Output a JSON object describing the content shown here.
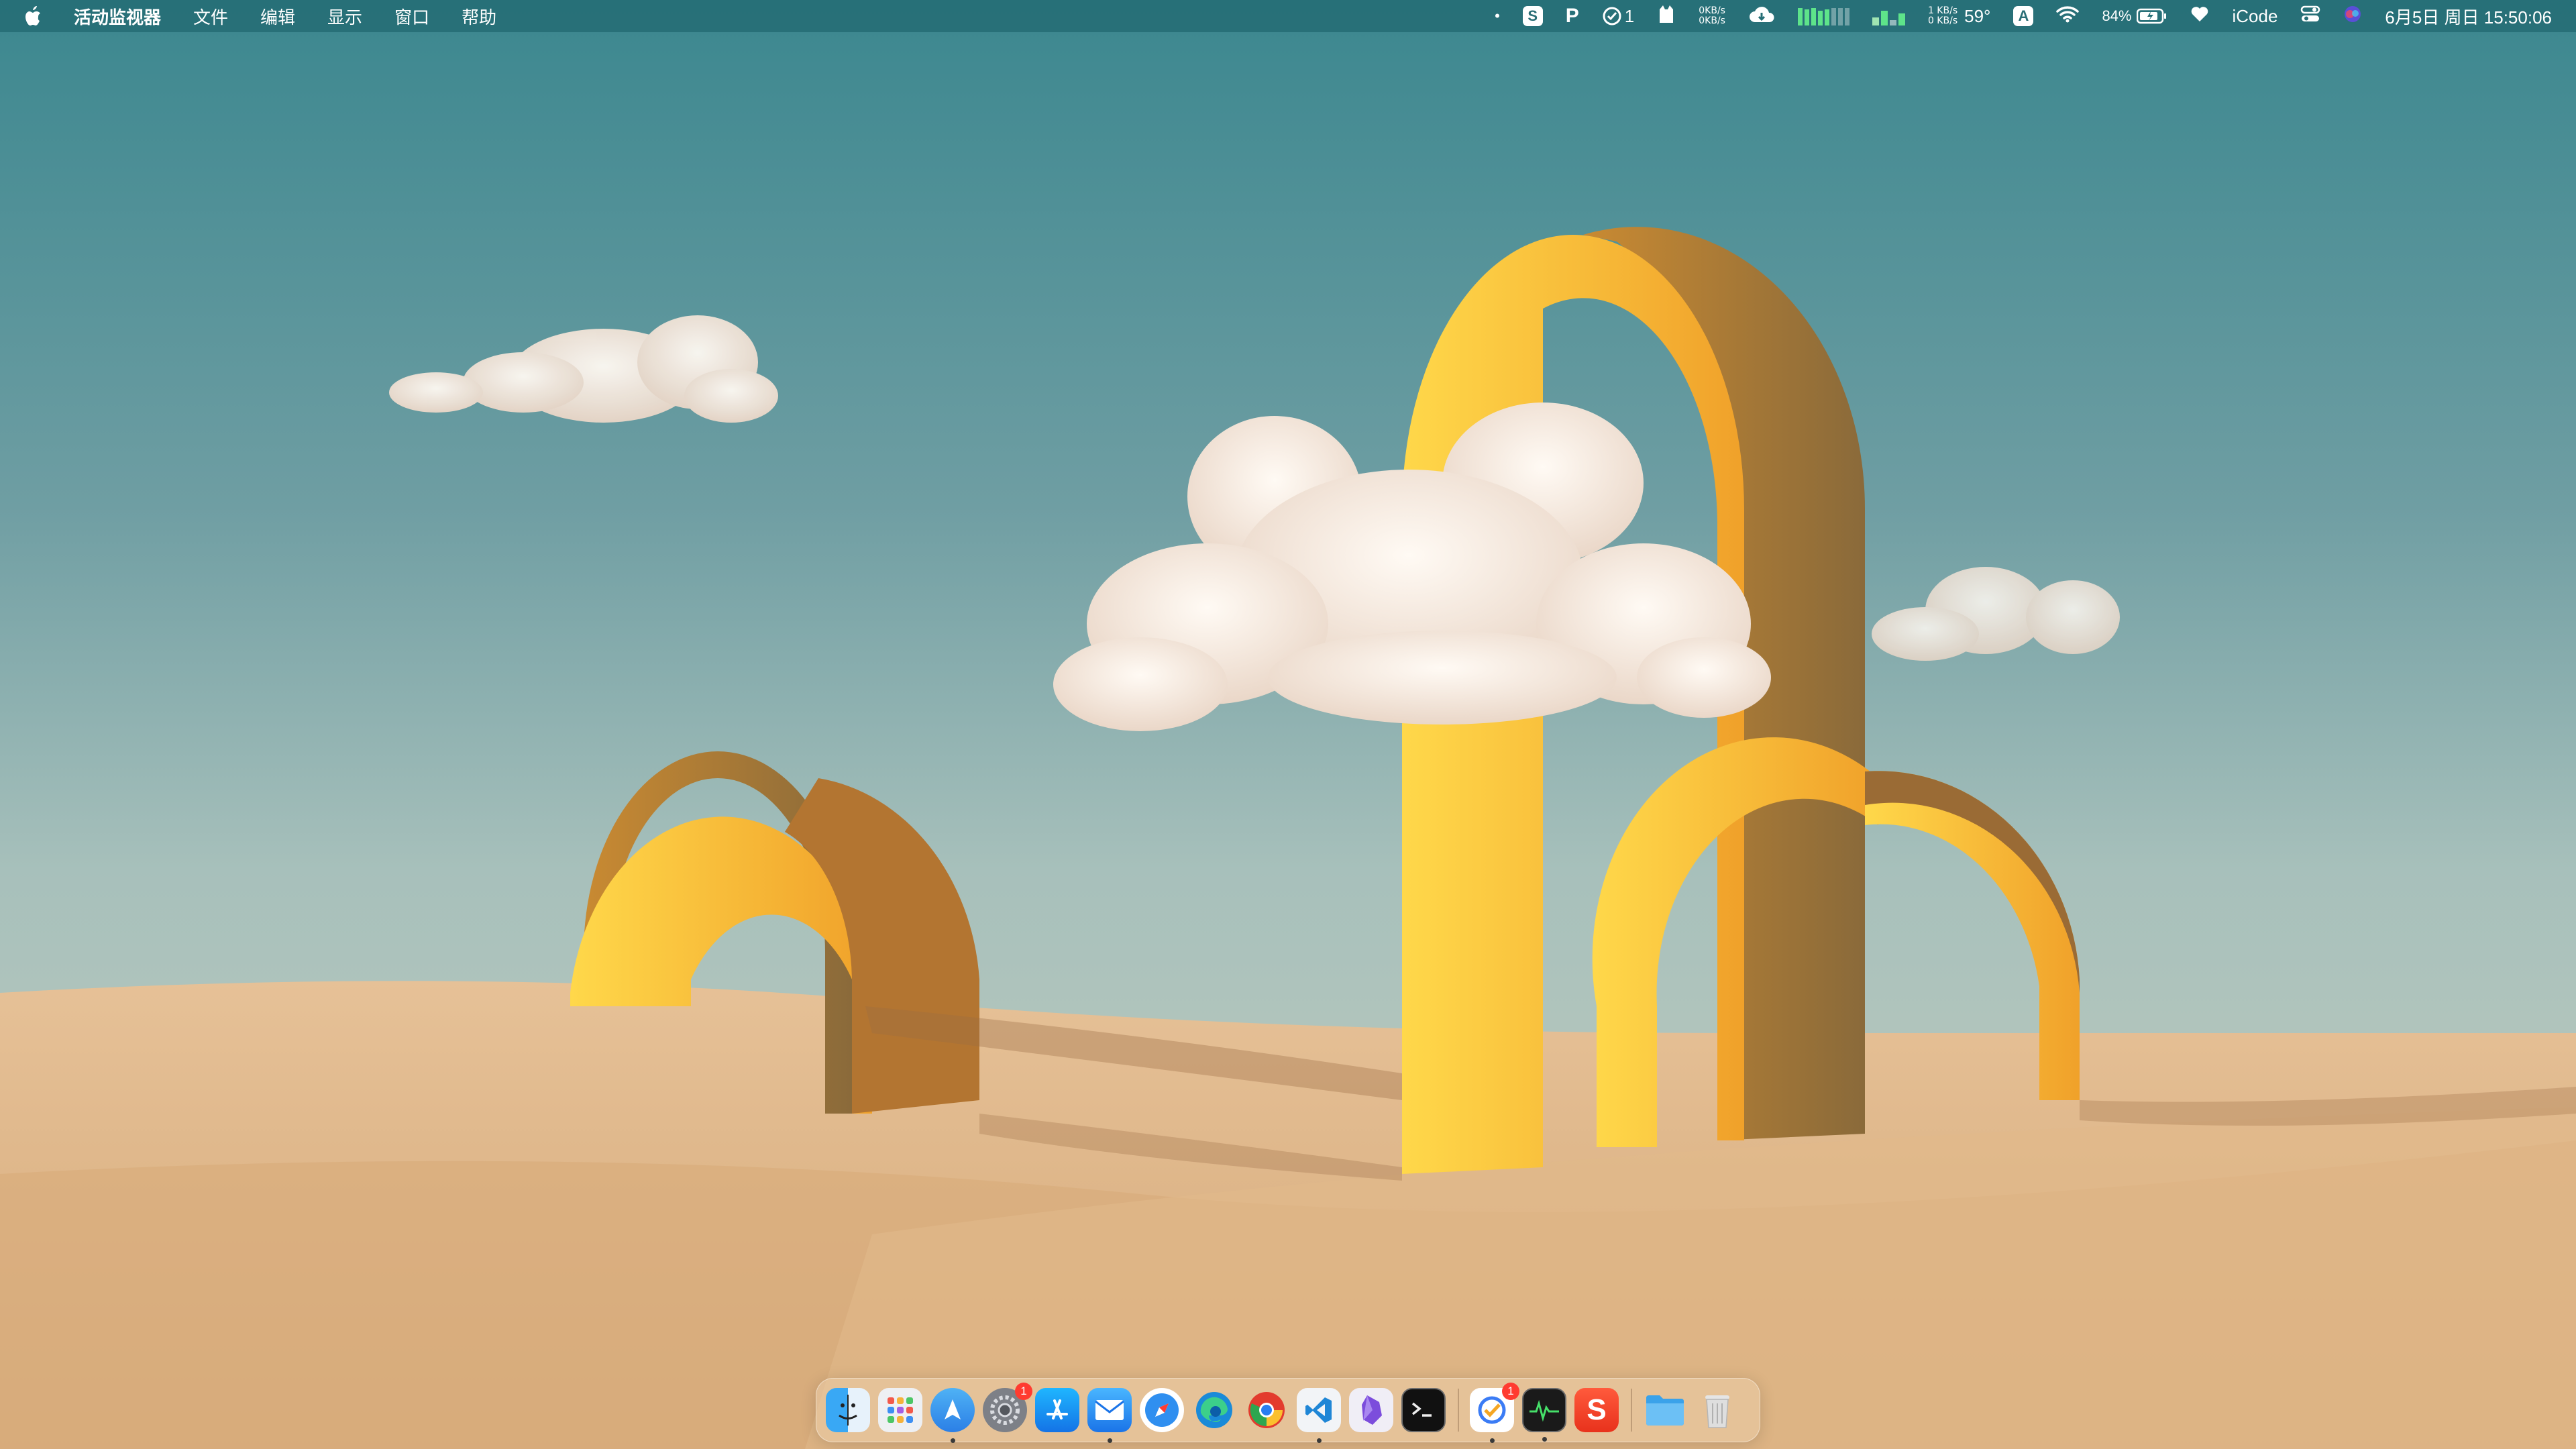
{
  "menubar": {
    "app_name": "活动监视器",
    "menus": [
      "文件",
      "编辑",
      "显示",
      "窗口",
      "帮助"
    ],
    "status": {
      "net_upload": "0KB/s",
      "net_download": "0KB/s",
      "net2_upload": "1 KB/s",
      "net2_download": "0 KB/s",
      "temperature": "59°",
      "input_source": "A",
      "checklist_count": "1",
      "battery_percent": "84%",
      "icode_label": "iCode",
      "datetime": "6月5日 周日 15:50:06"
    },
    "icons": [
      "apple-icon",
      "dot-icon",
      "skype-icon",
      "p-icon",
      "checklist-icon",
      "cat-icon",
      "cloud-icon",
      "cpu-graph-icon",
      "memory-graph-icon",
      "wifi-icon",
      "battery-icon",
      "heart-icon",
      "control-center-icon",
      "siri-icon"
    ]
  },
  "dock": {
    "apps": [
      {
        "name": "Finder",
        "icon": "finder-icon",
        "running": false
      },
      {
        "name": "Launchpad",
        "icon": "launchpad-icon",
        "running": false
      },
      {
        "name": "Maps",
        "icon": "maps-icon",
        "running": true
      },
      {
        "name": "System Preferences",
        "icon": "settings-icon",
        "running": false,
        "badge": "1"
      },
      {
        "name": "App Store",
        "icon": "app-store-icon",
        "running": false
      },
      {
        "name": "Mail",
        "icon": "mail-icon",
        "running": true
      },
      {
        "name": "Safari",
        "icon": "safari-icon",
        "running": false
      },
      {
        "name": "Edge",
        "icon": "edge-icon",
        "running": false
      },
      {
        "name": "Chrome",
        "icon": "chrome-icon",
        "running": false
      },
      {
        "name": "VS Code",
        "icon": "vscode-icon",
        "running": true
      },
      {
        "name": "Obsidian",
        "icon": "obsidian-icon",
        "running": false
      },
      {
        "name": "Terminal",
        "icon": "terminal-icon",
        "running": false
      },
      {
        "name": "Task App",
        "icon": "task-icon",
        "running": true,
        "badge": "1"
      },
      {
        "name": "Activity Monitor",
        "icon": "activity-monitor-icon",
        "running": true
      },
      {
        "name": "Sketch S",
        "icon": "s-app-icon",
        "running": false
      },
      {
        "name": "Folder",
        "icon": "folder-icon",
        "running": false
      },
      {
        "name": "Trash",
        "icon": "trash-icon",
        "running": false
      }
    ]
  },
  "colors": {
    "sky_top": "#3f8a93",
    "sky_bottom": "#a9c2bd",
    "sand": "#dcb486",
    "arch": "#f2b33a",
    "menubar": "#266e76"
  }
}
